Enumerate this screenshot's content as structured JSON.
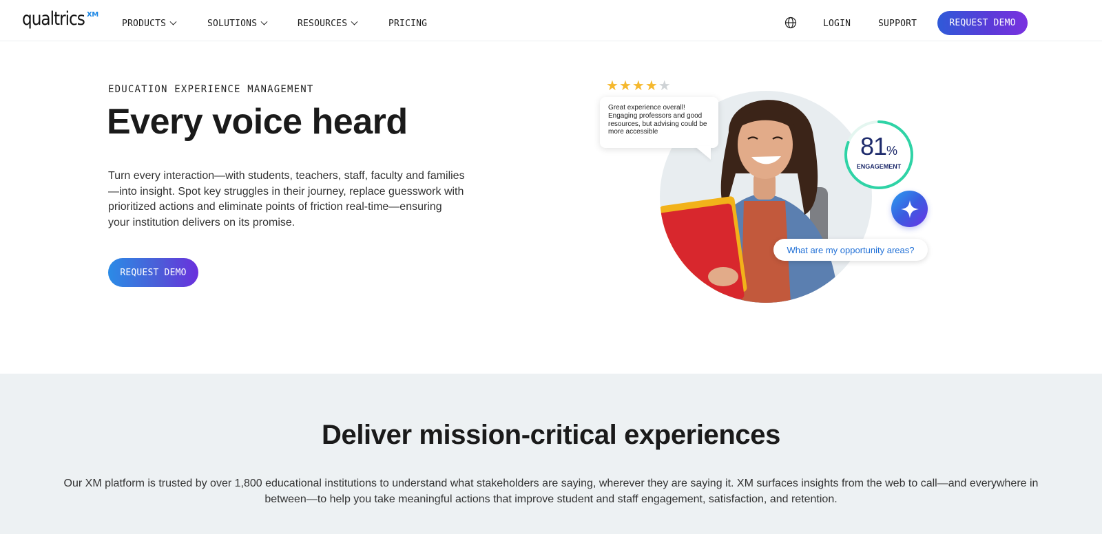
{
  "nav": {
    "logo_text": "qualtrics",
    "logo_mark": "XM",
    "items": [
      {
        "label": "PRODUCTS",
        "has_dropdown": true
      },
      {
        "label": "SOLUTIONS",
        "has_dropdown": true
      },
      {
        "label": "RESOURCES",
        "has_dropdown": true
      },
      {
        "label": "PRICING",
        "has_dropdown": false
      }
    ],
    "globe_icon": "globe-icon",
    "login_label": "LOGIN",
    "support_label": "SUPPORT",
    "demo_label": "REQUEST DEMO"
  },
  "hero": {
    "eyebrow": "EDUCATION EXPERIENCE MANAGEMENT",
    "title": "Every voice heard",
    "body": "Turn every interaction—with students, teachers, staff, faculty and families—into insight. Spot key struggles in their journey, replace guesswork with prioritized actions and eliminate points of friction real-time—ensuring your institution delivers on its promise.",
    "cta_label": "REQUEST DEMO"
  },
  "illustration": {
    "rating": 4,
    "rating_max": 5,
    "review_text": "Great experience overall! Engaging professors and good resources, but advising could be more accessible",
    "engagement_value": "81",
    "engagement_unit": "%",
    "engagement_fraction": 0.81,
    "engagement_label": "ENGAGEMENT",
    "ai_icon": "sparkle-icon",
    "question": "What are my opportunity areas?"
  },
  "section2": {
    "title": "Deliver mission-critical experiences",
    "body": "Our XM platform is trusted by over 1,800 educational institutions to understand what stakeholders are saying, wherever they are saying it. XM surfaces insights from the web to call—and everywhere in between—to help you take meaningful actions that improve student and staff engagement, satisfaction, and retention."
  },
  "colors": {
    "brand_gradient_start": "#2f5ad8",
    "brand_gradient_end": "#7a32e0",
    "ring_color": "#2fd3a6",
    "link_blue": "#1f6fd6",
    "section_bg": "#edf1f3"
  }
}
